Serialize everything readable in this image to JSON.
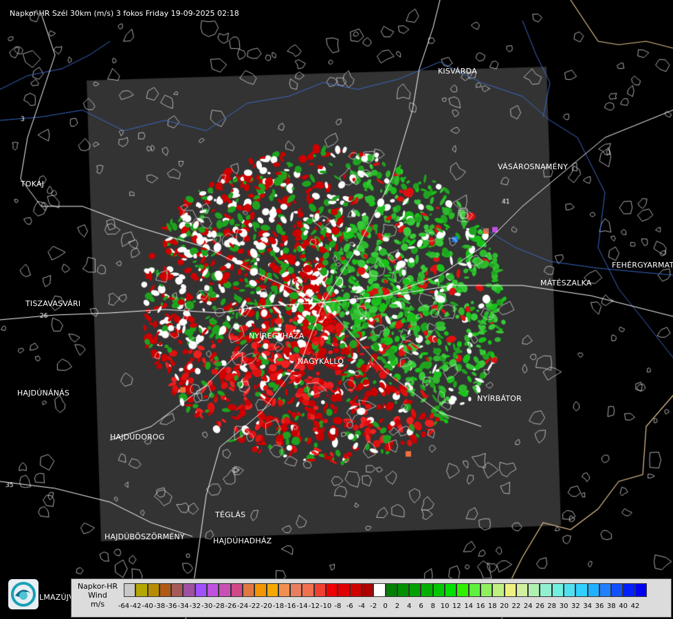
{
  "title": "Napkor-HR Szél 30km (m/s) 3 fokos Friday 19-09-2025 02:18",
  "cities": [
    {
      "name": "KISVÁRDA"
    },
    {
      "name": "VÁSÁROSNAMÉNY"
    },
    {
      "name": "TOKAJ"
    },
    {
      "name": "FEHÉRGYARMAT"
    },
    {
      "name": "MÁTÉSZALKA"
    },
    {
      "name": "TISZAVASVÁRI"
    },
    {
      "name": "NYÍREGYHÁZA"
    },
    {
      "name": "NAGYKÁLLÓ"
    },
    {
      "name": "NYÍRBÁTOR"
    },
    {
      "name": "HAJDÚNÁNÁS"
    },
    {
      "name": "HAJDÚDOROG"
    },
    {
      "name": "TÉGLÁS"
    },
    {
      "name": "HAJDÚBÖSZÖRMÉNY"
    },
    {
      "name": "HAJDÚHADHÁZ"
    },
    {
      "name": "LMAZÚJVÁR"
    }
  ],
  "road_labels": [
    "26",
    "35",
    "41",
    "3"
  ],
  "legend": {
    "line1": "Napkor-HR",
    "line2": "Wind",
    "line3": "m/s",
    "colors": [
      "#c8c8c8",
      "#b4a800",
      "#b88c00",
      "#b05a14",
      "#a85a5a",
      "#a050a0",
      "#a050ff",
      "#c050e0",
      "#c850b4",
      "#d04888",
      "#e07840",
      "#f49400",
      "#f4a800",
      "#f09050",
      "#e88060",
      "#f07050",
      "#f04030",
      "#f00000",
      "#e00000",
      "#d00000",
      "#b00000",
      "#ffffff",
      "#008000",
      "#009000",
      "#00a000",
      "#00b000",
      "#00c800",
      "#00e000",
      "#30f000",
      "#60f040",
      "#90f060",
      "#c0f080",
      "#f0f080",
      "#d0f0a0",
      "#b0f0b0",
      "#90f0d0",
      "#70f0e0",
      "#50e0f0",
      "#30d0ff",
      "#20b0ff",
      "#2080ff",
      "#1050ff",
      "#0020ff",
      "#0000f0"
    ],
    "ticks": [
      "-64",
      "-42",
      "-40",
      "-38",
      "-36",
      "-34",
      "-32",
      "-30",
      "-28",
      "-26",
      "-24",
      "-22",
      "-20",
      "-18",
      "-16",
      "-14",
      "-12",
      "-10",
      "-8",
      "-6",
      "-4",
      "-2",
      "0",
      "2",
      "4",
      "6",
      "8",
      "10",
      "12",
      "14",
      "16",
      "18",
      "20",
      "22",
      "24",
      "26",
      "28",
      "30",
      "32",
      "34",
      "36",
      "38",
      "40",
      "42"
    ]
  }
}
